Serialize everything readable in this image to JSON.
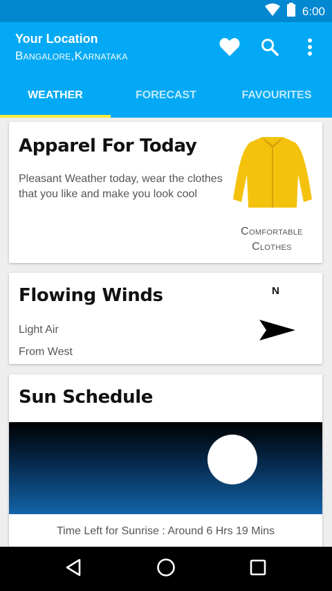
{
  "status": {
    "time": "6:00"
  },
  "header": {
    "title": "Your Location",
    "location": "Bangalore,Karnataka"
  },
  "tabs": [
    {
      "label": "WEATHER"
    },
    {
      "label": "FORECAST"
    },
    {
      "label": "FAVOURITES"
    }
  ],
  "apparel": {
    "title": "Apparel For Today",
    "description": "Pleasant Weather today, wear the clothes that you like and make you look cool",
    "label": "Comfortable Clothes"
  },
  "winds": {
    "title": "Flowing Winds",
    "strength": "Light Air",
    "direction": "From West",
    "compass_label": "N"
  },
  "sun": {
    "title": "Sun Schedule",
    "sunrise_text": "Time Left for Sunrise : Around 6 Hrs 19 Mins"
  },
  "colors": {
    "status_bar": "#0288d1",
    "app_bar": "#03a9f4",
    "tab_indicator": "#ffeb3b",
    "jacket": "#f4c20d"
  },
  "icons": {
    "status": [
      "wifi-icon",
      "battery-icon"
    ],
    "actions": [
      "heart-icon",
      "search-icon",
      "more-vert-icon"
    ],
    "navigation": [
      "back-icon",
      "home-icon",
      "recents-icon"
    ]
  }
}
